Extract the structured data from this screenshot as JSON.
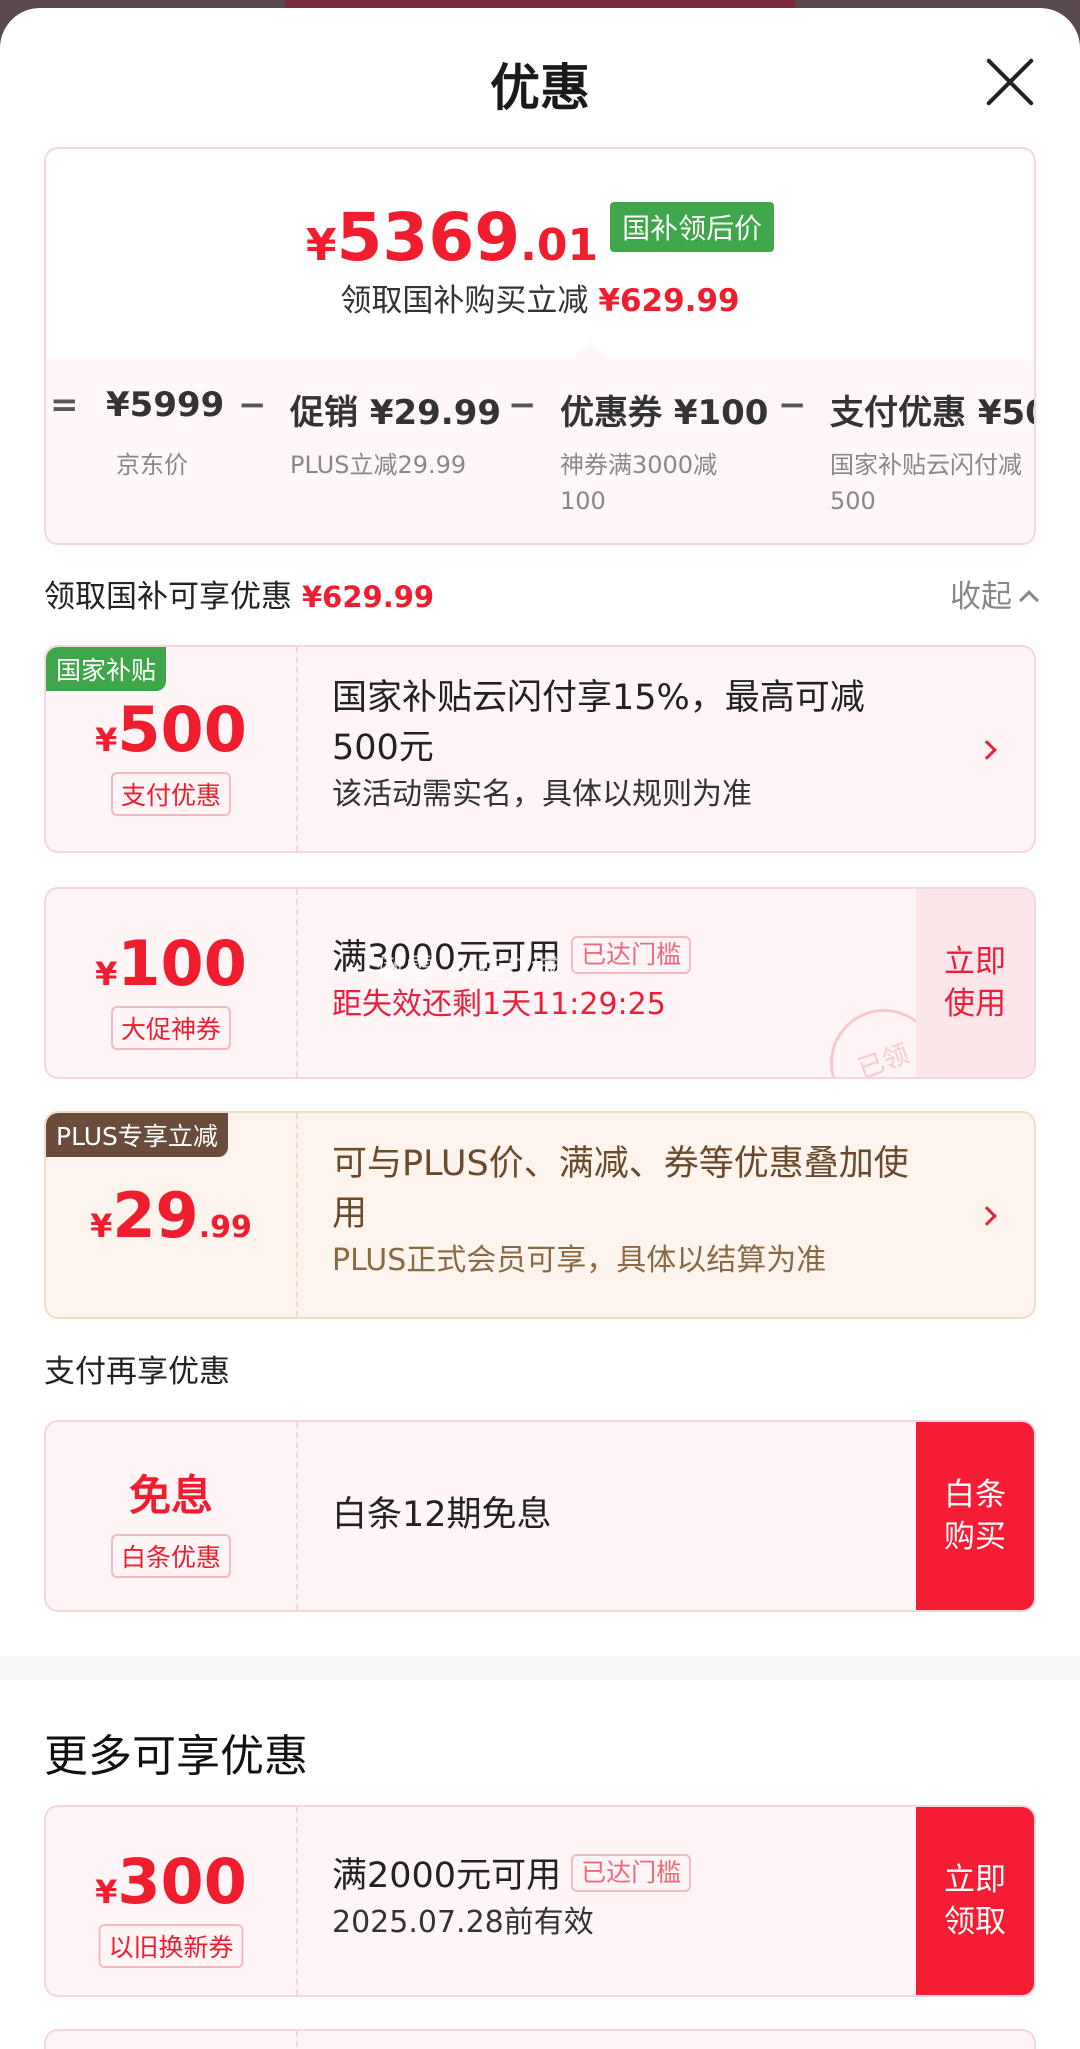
{
  "header": {
    "title": "优惠"
  },
  "price_card": {
    "yen": "¥",
    "price_int": "5369",
    "price_dec": ".01",
    "price_tag": "国补领后价",
    "sub_text": "领取国补购买立减",
    "sub_amount": "¥629.99",
    "calc": {
      "eq": "=",
      "items": [
        {
          "value": "¥5999",
          "note": "京东价"
        },
        {
          "op": "−",
          "value": "促销 ¥29.99",
          "note": "PLUS立减29.99"
        },
        {
          "op": "−",
          "value": "优惠券 ¥100",
          "note": "神券满3000减\n100"
        },
        {
          "op": "−",
          "value": "支付优惠 ¥50",
          "note": "国家补贴云闪付减\n500"
        }
      ]
    }
  },
  "subsidy_section": {
    "label": "领取国补可享优惠",
    "amount": "¥629.99",
    "collapse": "收起"
  },
  "coupons": [
    {
      "corner": "国家补贴",
      "yen": "¥",
      "amount": "500",
      "label": "支付优惠",
      "title": "国家补贴云闪付享15%，最高可减500元",
      "desc": "该活动需实名，具体以规则为准"
    },
    {
      "yen": "¥",
      "amount": "100",
      "label": "大促神券",
      "title": "满3000元可用",
      "badge": "已达门槛",
      "desc": "距失效还剩1天11:29:25",
      "button": "立即使用",
      "stamp": "已领",
      "watermark": "傲雪 人在D城"
    },
    {
      "corner": "PLUS专享立减",
      "yen": "¥",
      "amount": "29",
      "amount_dec": ".99",
      "title": "可与PLUS价、满减、券等优惠叠加使用",
      "desc": "PLUS正式会员可享，具体以结算为准"
    }
  ],
  "payment_section": {
    "label": "支付再享优惠",
    "card": {
      "amount": "免息",
      "label": "白条优惠",
      "title": "白条12期免息",
      "button": "白条购买"
    }
  },
  "more_section": {
    "label": "更多可享优惠",
    "card": {
      "yen": "¥",
      "amount": "300",
      "label": "以旧换新券",
      "title": "满2000元可用",
      "badge": "已达门槛",
      "desc": "2025.07.28前有效",
      "button": "立即领取"
    }
  },
  "colors": {
    "accent": "#f01d2f",
    "subsidy_tag": "#3fa64a",
    "plus_tag": "#6b4c3b"
  }
}
